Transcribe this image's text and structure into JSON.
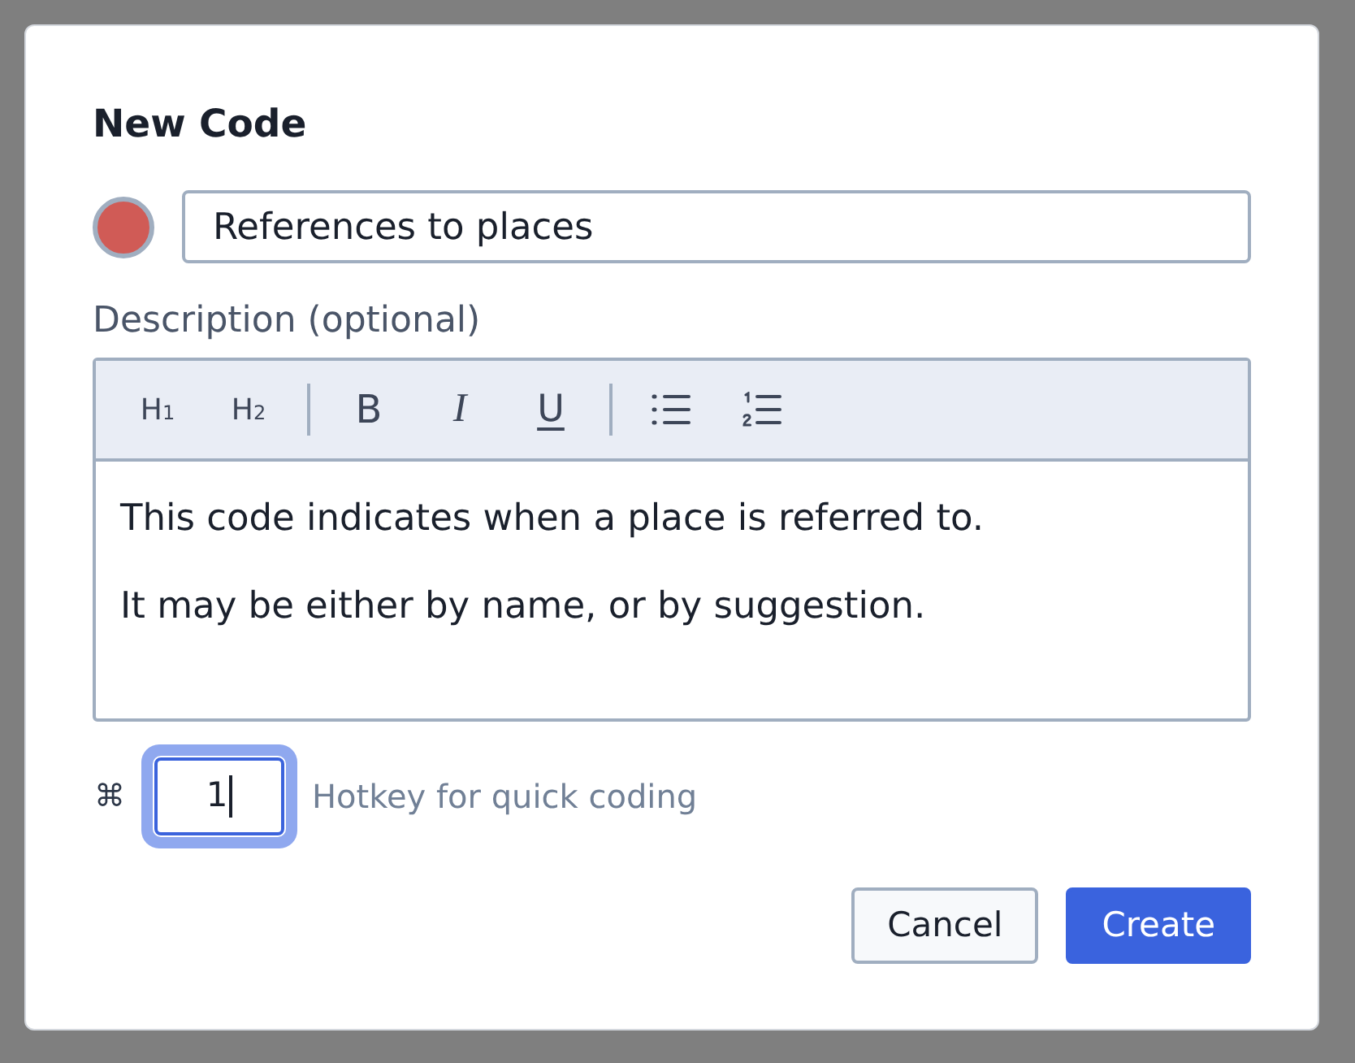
{
  "dialog": {
    "title": "New Code"
  },
  "code": {
    "color": "#d05b56",
    "name": "References to places"
  },
  "description": {
    "label": "Description (optional)",
    "toolbar": [
      {
        "kind": "heading",
        "label": "H$_{1}$"
      },
      {
        "kind": "heading",
        "label": "H$_{2}$"
      },
      {
        "kind": "divider"
      },
      {
        "kind": "bold",
        "label": "B"
      },
      {
        "kind": "italic",
        "label": "I"
      },
      {
        "kind": "underline",
        "label": "U"
      },
      {
        "kind": "divider"
      },
      {
        "kind": "bullet_list"
      },
      {
        "kind": "ordered_list"
      }
    ],
    "paragraphs": [
      "This code indicates when a place is referred to.",
      "It may be either by name, or by suggestion."
    ]
  },
  "hotkey": {
    "modifier": "⌘",
    "value": "1",
    "focused": true,
    "hint": "Hotkey for quick coding"
  },
  "buttons": [
    {
      "label": "Cancel",
      "kind": "secondary"
    },
    {
      "label": "Create",
      "kind": "primary"
    }
  ]
}
